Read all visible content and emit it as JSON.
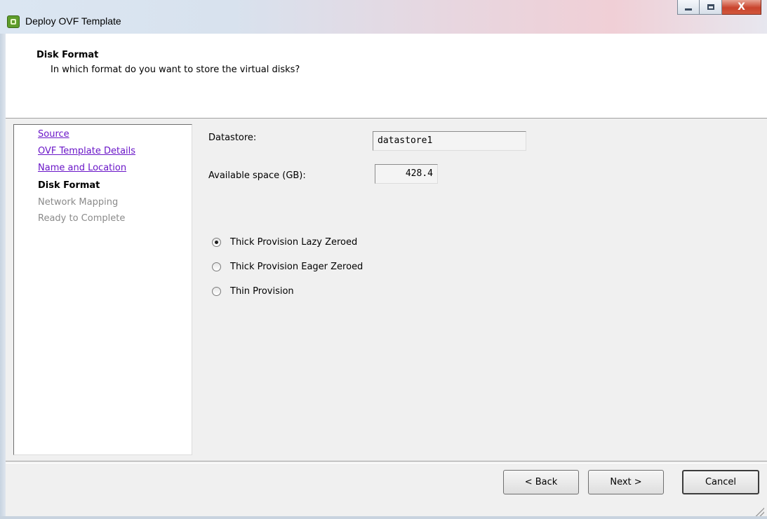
{
  "window": {
    "title": "Deploy OVF Template",
    "controls": {
      "minimize": "minimize",
      "maximize": "maximize",
      "close": "X"
    }
  },
  "header": {
    "title": "Disk Format",
    "subtitle": "In which format do you want to store the virtual disks?"
  },
  "steps": [
    {
      "label": "Source",
      "state": "link"
    },
    {
      "label": "OVF Template Details",
      "state": "link"
    },
    {
      "label": "Name and Location",
      "state": "link"
    },
    {
      "label": "Disk Format",
      "state": "current"
    },
    {
      "label": "Network Mapping",
      "state": "disabled"
    },
    {
      "label": "Ready to Complete",
      "state": "disabled"
    }
  ],
  "form": {
    "datastore_label": "Datastore:",
    "datastore_value": "datastore1",
    "space_label": "Available space (GB):",
    "space_value": "428.4"
  },
  "disk_format_options": [
    {
      "label": "Thick Provision Lazy Zeroed",
      "selected": true
    },
    {
      "label": "Thick Provision Eager Zeroed",
      "selected": false
    },
    {
      "label": "Thin Provision",
      "selected": false
    }
  ],
  "buttons": {
    "back": "< Back",
    "next": "Next >",
    "cancel": "Cancel"
  },
  "colors": {
    "link": "#6a16c8",
    "disabled_text": "#8a8a8a"
  }
}
